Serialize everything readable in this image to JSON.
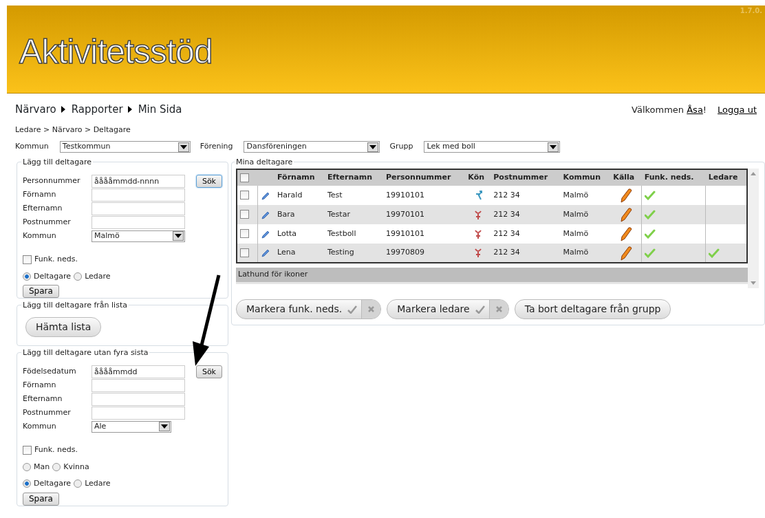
{
  "header": {
    "logo": "Aktivitetsstöd",
    "version": "1.7.0."
  },
  "menu": [
    {
      "label": "Närvaro"
    },
    {
      "label": "Rapporter"
    },
    {
      "label": "Min Sida"
    }
  ],
  "welcome": {
    "text": "Välkommen",
    "user": "Åsa",
    "suffix": "!",
    "logout": "Logga ut"
  },
  "breadcrumb": "Ledare > Närvaro > Deltagare",
  "filters": [
    {
      "label": "Kommun",
      "value": "Testkommun"
    },
    {
      "label": "Förening",
      "value": "Dansföreningen"
    },
    {
      "label": "Grupp",
      "value": "Lek med boll"
    }
  ],
  "panels": [
    {
      "kind": "form",
      "title": "Lägg till deltagare",
      "fields": [
        {
          "label": "Personnummer",
          "kind": "text",
          "value": "ååååmmdd-nnnn"
        },
        {
          "label": "Förnamn",
          "kind": "text"
        },
        {
          "label": "Efternamn",
          "kind": "text"
        },
        {
          "label": "Postnummer",
          "kind": "text"
        },
        {
          "label": "Kommun",
          "kind": "select",
          "value": "Malmö"
        }
      ],
      "search_button": "Sök",
      "search_focused": true,
      "checkbox": {
        "label": "Funk. neds.",
        "checked": false
      },
      "radio_groups": [
        [
          {
            "label": "Deltagare",
            "selected": true
          },
          {
            "label": "Ledare",
            "selected": false
          }
        ]
      ],
      "save_button": "Spara"
    },
    {
      "kind": "list",
      "title": "Lägg till deltagare från lista",
      "button": "Hämta lista"
    },
    {
      "kind": "form",
      "title": "Lägg till deltagare utan fyra sista",
      "fields": [
        {
          "label": "Födelsedatum",
          "kind": "text",
          "value": "ååååmmdd"
        },
        {
          "label": "Förnamn",
          "kind": "text"
        },
        {
          "label": "Efternamn",
          "kind": "text"
        },
        {
          "label": "Postnummer",
          "kind": "text"
        },
        {
          "label": "Kommun",
          "kind": "select",
          "value": "Ale"
        }
      ],
      "search_button": "Sök",
      "search_focused": false,
      "checkbox": {
        "label": "Funk. neds.",
        "checked": false
      },
      "radio_groups": [
        [
          {
            "label": "Man",
            "selected": false
          },
          {
            "label": "Kvinna",
            "selected": false
          }
        ],
        [
          {
            "label": "Deltagare",
            "selected": true
          },
          {
            "label": "Ledare",
            "selected": false
          }
        ]
      ],
      "save_button": "Spara"
    }
  ],
  "participants": {
    "title": "Mina deltagare",
    "columns": [
      "Förnamn",
      "Efternamn",
      "Personnummer",
      "Kön",
      "Postnummer",
      "Kommun",
      "Källa",
      "Funk. neds.",
      "Ledare"
    ],
    "all_checked": false,
    "rows": [
      {
        "checked": false,
        "first": "Harald",
        "last": "Test",
        "pnr": "19910101",
        "kind": "male",
        "zip": "212 34",
        "municipality": "Malmö",
        "funk": true,
        "leader": false
      },
      {
        "checked": false,
        "first": "Bara",
        "last": "Testar",
        "pnr": "19970101",
        "kind": "female",
        "zip": "212 34",
        "municipality": "Malmö",
        "funk": true,
        "leader": false
      },
      {
        "checked": false,
        "first": "Lotta",
        "last": "Testboll",
        "pnr": "19910101",
        "kind": "female",
        "zip": "212 34",
        "municipality": "Malmö",
        "funk": true,
        "leader": false
      },
      {
        "checked": false,
        "first": "Lena",
        "last": "Testing",
        "pnr": "19970809",
        "kind": "female",
        "zip": "212 34",
        "municipality": "Malmö",
        "funk": true,
        "leader": true
      }
    ],
    "legend": "Lathund för ikoner",
    "actions": [
      {
        "label": "Markera funk. neds.",
        "kind": "toggle"
      },
      {
        "label": "Markera ledare",
        "kind": "toggle"
      },
      {
        "label": "Ta bort deltagare från grupp",
        "kind": "plain"
      }
    ]
  }
}
